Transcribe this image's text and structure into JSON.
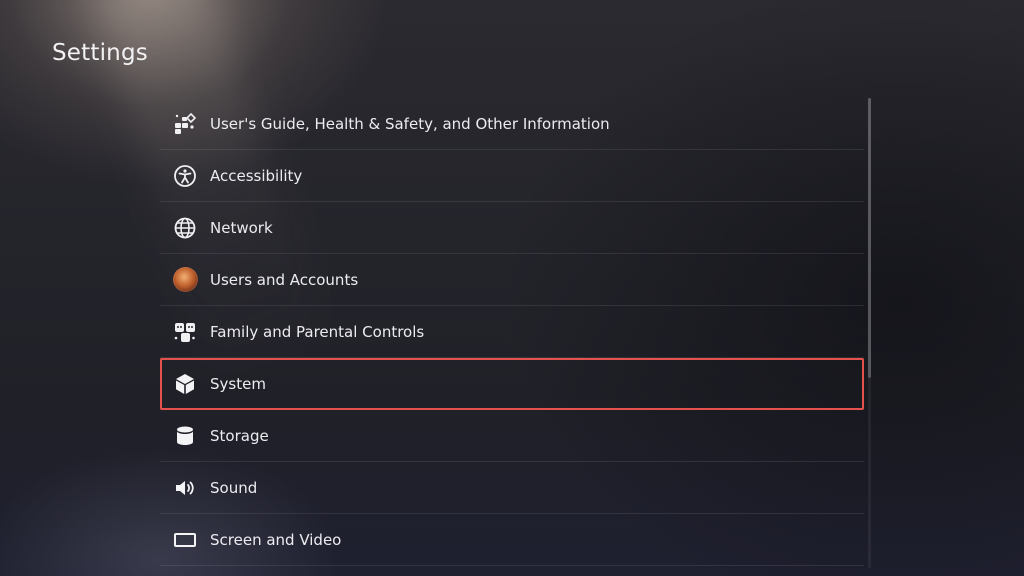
{
  "page": {
    "title": "Settings"
  },
  "menu": {
    "items": [
      {
        "label": "User's Guide, Health & Safety, and Other Information",
        "icon": "guide-icon"
      },
      {
        "label": "Accessibility",
        "icon": "accessibility-icon"
      },
      {
        "label": "Network",
        "icon": "globe-icon"
      },
      {
        "label": "Users and Accounts",
        "icon": "user-avatar-icon"
      },
      {
        "label": "Family and Parental Controls",
        "icon": "family-icon"
      },
      {
        "label": "System",
        "icon": "cube-icon",
        "selected": true
      },
      {
        "label": "Storage",
        "icon": "storage-cylinder-icon"
      },
      {
        "label": "Sound",
        "icon": "speaker-icon"
      },
      {
        "label": "Screen and Video",
        "icon": "screen-icon"
      }
    ]
  },
  "colors": {
    "selection_border": "#e5524d",
    "text": "#ececf0",
    "background": "#24242b"
  }
}
